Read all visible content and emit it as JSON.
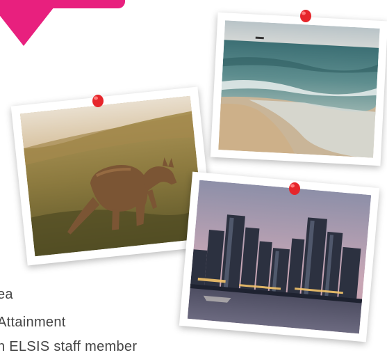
{
  "colors": {
    "accent": "#e8207e",
    "pin": "#e6262b",
    "text": "#444444"
  },
  "banner": {
    "color": "#e8207e"
  },
  "photos": [
    {
      "subject": "beach shoreline with waves and a distant ship"
    },
    {
      "subject": "kangaroo grazing in a grassy field"
    },
    {
      "subject": "city skyline at dusk across a river"
    }
  ],
  "text_lines": [
    "ea",
    "Attainment",
    "n ELSIS staff member"
  ]
}
